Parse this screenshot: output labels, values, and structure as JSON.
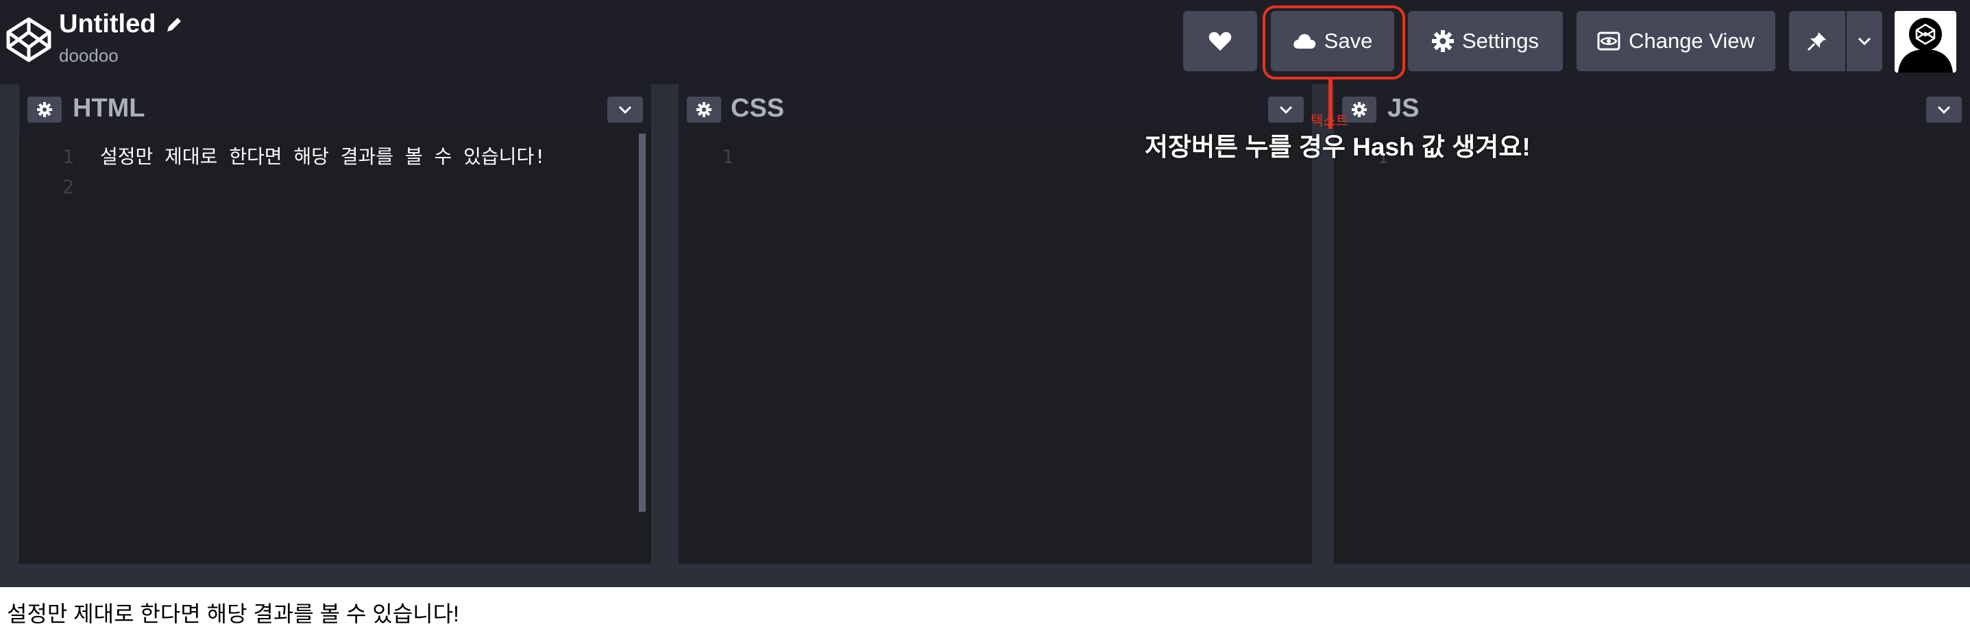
{
  "header": {
    "title": "Untitled",
    "owner": "doodoo",
    "buttons": {
      "save": "Save",
      "settings": "Settings",
      "change_view": "Change View"
    }
  },
  "annotation": {
    "small_label": "텍스트",
    "text": "저장버튼 누를 경우 Hash 값 생겨요!",
    "color": "#e8321e"
  },
  "editors": {
    "html": {
      "title": "HTML",
      "line_numbers": "1\n2",
      "code": "설정만 제대로 한다면 해당 결과를 볼 수 있습니다!"
    },
    "css": {
      "title": "CSS",
      "line_numbers": "1",
      "code": ""
    },
    "js": {
      "title": "JS",
      "line_numbers": "1",
      "code": ""
    }
  },
  "preview": {
    "text": "설정만 제대로 한다면 해당 결과를 볼 수 있습니다!"
  },
  "icons": [
    "codepen-logo-icon",
    "pencil-icon",
    "heart-icon",
    "cloud-icon",
    "gear-icon",
    "eye-icon",
    "pin-icon",
    "chevron-down-icon"
  ]
}
